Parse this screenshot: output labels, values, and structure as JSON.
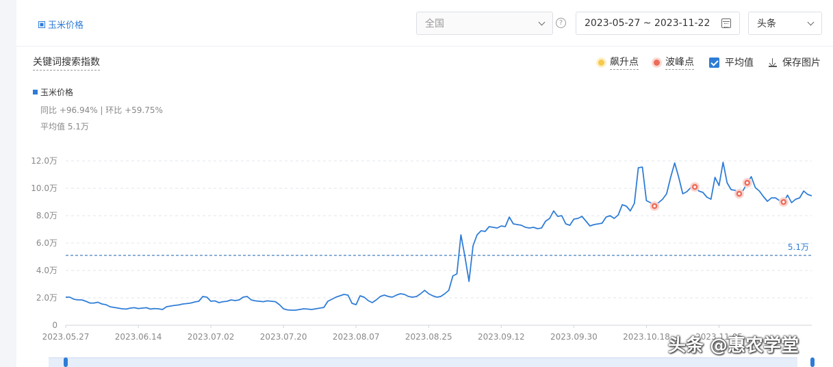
{
  "header": {
    "keyword_tag": "玉米价格",
    "region": "全国",
    "date_range": "2023-05-27 ~ 2023-11-22",
    "source": "头条"
  },
  "panel": {
    "title": "关键词搜索指数",
    "tools": {
      "surge_label": "飙升点",
      "peak_label": "波峰点",
      "average_label": "平均值",
      "save_label": "保存图片"
    }
  },
  "legend": {
    "series_name": "玉米价格",
    "comparison": "同比 +96.94% | 环比 +59.75%",
    "average_text": "平均值 5.1万"
  },
  "watermark": "头条 @惠农学堂",
  "colors": {
    "line": "#2e7cd6",
    "peak": "#ec6b5a",
    "surge": "#f7c948",
    "avg": "#1a5ea8"
  },
  "chart_data": {
    "type": "line",
    "start_date": "2023-05-27",
    "end_date": "2023-11-22",
    "xlabel": "",
    "ylabel": "",
    "ylim": [
      0,
      12
    ],
    "y_unit": "万",
    "yticks": [
      0,
      2,
      4,
      6,
      8,
      10,
      12
    ],
    "ytick_labels": [
      "0",
      "2.0万",
      "4.0万",
      "6.0万",
      "8.0万",
      "10.0万",
      "12.0万"
    ],
    "xtick_labels": [
      "2023.05.27",
      "2023.06.14",
      "2023.07.02",
      "2023.07.20",
      "2023.08.07",
      "2023.08.25",
      "2023.09.12",
      "2023.09.30",
      "2023.10.18",
      "2023.11.05"
    ],
    "grid": true,
    "average": 5.1,
    "average_label": "5.1万",
    "series": [
      {
        "name": "玉米价格",
        "values": [
          2.05,
          2.05,
          1.9,
          1.85,
          1.85,
          1.75,
          1.62,
          1.62,
          1.68,
          1.55,
          1.5,
          1.35,
          1.3,
          1.25,
          1.2,
          1.18,
          1.25,
          1.28,
          1.22,
          1.25,
          1.28,
          1.18,
          1.22,
          1.2,
          1.15,
          1.35,
          1.4,
          1.45,
          1.48,
          1.55,
          1.58,
          1.62,
          1.7,
          1.75,
          2.1,
          2.05,
          1.75,
          1.78,
          1.65,
          1.72,
          1.75,
          1.85,
          1.8,
          1.85,
          2.05,
          2.1,
          1.85,
          1.78,
          1.75,
          1.72,
          1.78,
          1.75,
          1.72,
          1.5,
          1.2,
          1.12,
          1.1,
          1.1,
          1.15,
          1.2,
          1.18,
          1.15,
          1.2,
          1.25,
          1.3,
          1.75,
          1.9,
          2.05,
          2.15,
          2.25,
          2.2,
          1.6,
          1.5,
          2.15,
          2.05,
          1.8,
          1.65,
          1.85,
          2.1,
          2.2,
          2.1,
          2.05,
          2.2,
          2.3,
          2.25,
          2.1,
          2.05,
          2.1,
          2.3,
          2.55,
          2.3,
          2.15,
          2.05,
          2.1,
          2.3,
          2.55,
          3.6,
          3.75,
          6.6,
          5.0,
          3.2,
          5.8,
          6.6,
          6.9,
          6.85,
          7.2,
          7.15,
          7.1,
          7.25,
          7.2,
          7.9,
          7.4,
          7.35,
          7.3,
          7.15,
          7.1,
          7.15,
          7.05,
          7.1,
          7.6,
          7.8,
          8.35,
          7.95,
          8.0,
          7.4,
          7.3,
          7.75,
          7.8,
          7.95,
          7.6,
          7.25,
          7.35,
          7.4,
          7.45,
          7.9,
          8.0,
          7.8,
          8.05,
          8.8,
          8.7,
          8.35,
          8.9,
          11.5,
          11.55,
          9.1,
          8.95,
          8.7,
          8.95,
          9.2,
          9.6,
          10.8,
          11.85,
          10.8,
          9.6,
          9.75,
          10.05,
          10.1,
          9.8,
          9.7,
          9.35,
          9.2,
          10.8,
          10.2,
          11.9,
          10.4,
          9.9,
          9.85,
          9.6,
          9.85,
          10.4,
          10.85,
          10.05,
          9.8,
          9.4,
          9.05,
          9.3,
          9.3,
          9.1,
          9.0,
          9.5,
          8.95,
          9.2,
          9.3,
          9.8,
          9.55,
          9.45
        ]
      }
    ],
    "peak_indices": [
      146,
      156,
      167,
      169,
      178
    ]
  }
}
